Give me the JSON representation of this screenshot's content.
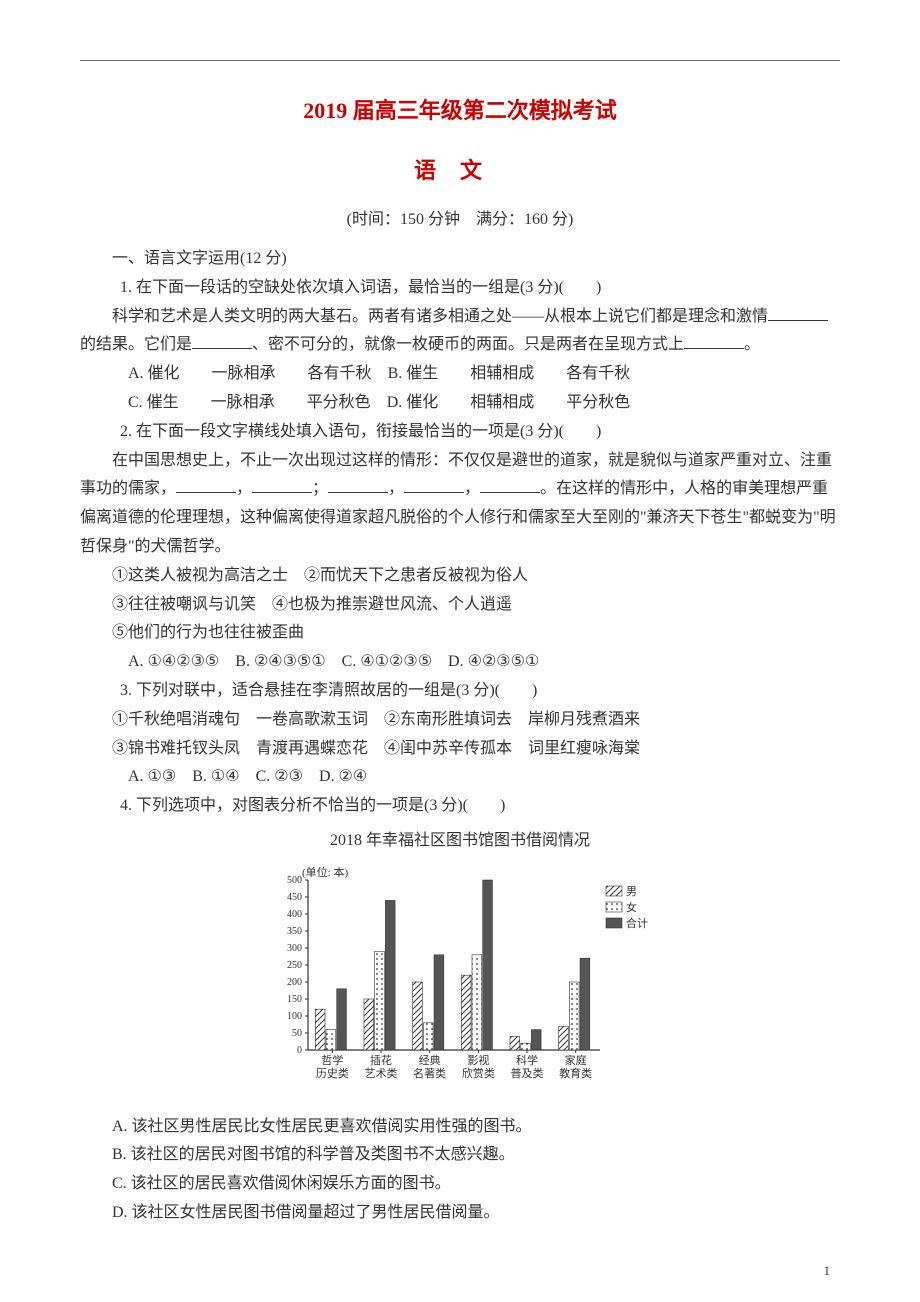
{
  "header": {
    "title_main": "2019 届高三年级第二次模拟考试",
    "title_sub": "语文",
    "exam_info": "(时间：150 分钟　满分：160 分)"
  },
  "section1": {
    "heading": "一、语言文字运用(12 分)",
    "q1": {
      "stem": "1. 在下面一段话的空缺处依次填入词语，最恰当的一组是(3 分)(　　)",
      "passage_a": "科学和艺术是人类文明的两大基石。两者有诸多相通之处——从根本上说它们都是理念和激情",
      "passage_b": "的结果。它们是",
      "passage_c": "、密不可分的，就像一枚硬币的两面。只是两者在呈现方式上",
      "passage_d": "。",
      "optA": "A. 催化　　一脉相承　　各有千秋",
      "optB": "B. 催生　　相辅相成　　各有千秋",
      "optC": "C. 催生　　一脉相承　　平分秋色",
      "optD": "D. 催化　　相辅相成　　平分秋色"
    },
    "q2": {
      "stem": "2. 在下面一段文字横线处填入语句，衔接最恰当的一项是(3 分)(　　)",
      "passage_a": "在中国思想史上，不止一次出现过这样的情形：不仅仅是避世的道家，就是貌似与道家严重对立、注重事功的儒家，",
      "passage_mid_sep": "，",
      "passage_mid_semicolon": "；",
      "passage_b": "。在这样的情形中，人格的审美理想严重偏离道德的伦理理想，这种偏离使得道家超凡脱俗的个人修行和儒家至大至刚的\"兼济天下苍生\"都蜕变为\"明哲保身\"的犬儒哲学。",
      "line1": "①这类人被视为高洁之士　②而忧天下之患者反被视为俗人",
      "line2": "③往往被嘲讽与讥笑　④也极为推崇避世风流、个人逍遥",
      "line3": "⑤他们的行为也往往被歪曲",
      "opts": "A. ①④②③⑤　B. ②④③⑤①　C. ④①②③⑤　D. ④②③⑤①"
    },
    "q3": {
      "stem": "3. 下列对联中，适合悬挂在李清照故居的一组是(3 分)(　　)",
      "line1": "①千秋绝唱消魂句　一卷高歌漱玉词　②东南形胜填词去　岸柳月残煮酒来",
      "line2": "③锦书难托钗头凤　青渡再遇蝶恋花　④闺中苏辛传孤本　词里红瘦咏海棠",
      "opts": "A. ①③　B. ①④　C. ②③　D. ②④"
    },
    "q4": {
      "stem": "4. 下列选项中，对图表分析不恰当的一项是(3 分)(　　)",
      "chart_title": "2018 年幸福社区图书馆图书借阅情况",
      "optA": "A. 该社区男性居民比女性居民更喜欢借阅实用性强的图书。",
      "optB": "B. 该社区的居民对图书馆的科学普及类图书不太感兴趣。",
      "optC": "C. 该社区的居民喜欢借阅休闲娱乐方面的图书。",
      "optD": "D. 该社区女性居民图书借阅量超过了男性居民借阅量。"
    }
  },
  "chart_data": {
    "type": "bar",
    "title": "2018 年幸福社区图书馆图书借阅情况",
    "unit": "(单位: 本)",
    "ylabel": "",
    "ylim": [
      0,
      500
    ],
    "yticks": [
      0,
      50,
      100,
      150,
      200,
      250,
      300,
      350,
      400,
      450,
      500
    ],
    "categories": [
      "哲学历史类",
      "插花艺术类",
      "经典名著类",
      "影视欣赏类",
      "科学普及类",
      "家庭教育类"
    ],
    "series": [
      {
        "name": "男",
        "values": [
          120,
          150,
          200,
          220,
          40,
          70
        ],
        "pattern": "diag"
      },
      {
        "name": "女",
        "values": [
          60,
          290,
          80,
          280,
          20,
          200
        ],
        "pattern": "dots"
      },
      {
        "name": "合计",
        "values": [
          180,
          440,
          280,
          500,
          60,
          270
        ],
        "pattern": "solid"
      }
    ],
    "legend": [
      "男",
      "女",
      "合计"
    ]
  },
  "page_number": "1"
}
